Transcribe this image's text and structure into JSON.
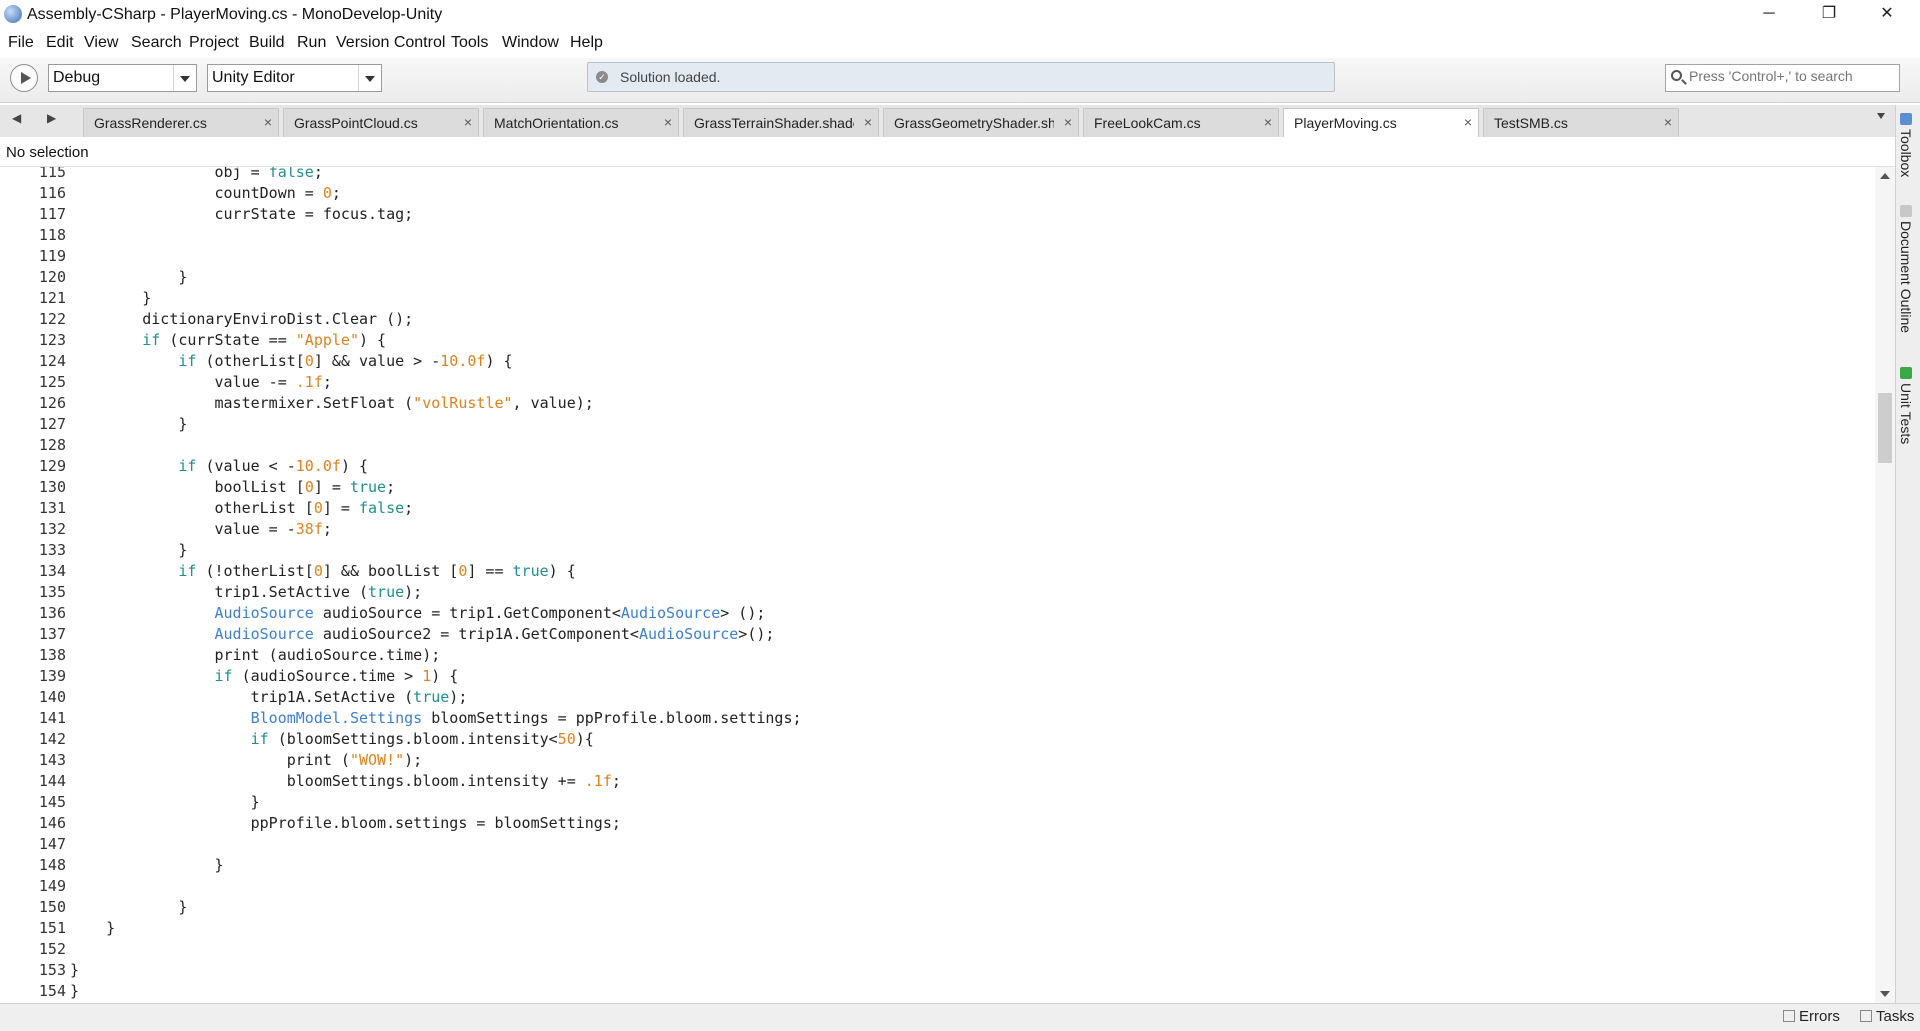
{
  "window": {
    "title": "Assembly-CSharp - PlayerMoving.cs - MonoDevelop-Unity",
    "minimize": "─",
    "restore": "❐",
    "close": "✕"
  },
  "menu": [
    "File",
    "Edit",
    "View",
    "Search",
    "Project",
    "Build",
    "Run",
    "Version Control",
    "Tools",
    "Window",
    "Help"
  ],
  "toolbar": {
    "config": "Debug",
    "target": "Unity Editor",
    "status": "Solution loaded.",
    "search_placeholder": "Press 'Control+,' to search"
  },
  "tabs": [
    {
      "label": "GrassRenderer.cs",
      "active": false
    },
    {
      "label": "GrassPointCloud.cs",
      "active": false
    },
    {
      "label": "MatchOrientation.cs",
      "active": false
    },
    {
      "label": "GrassTerrainShader.shader",
      "active": false
    },
    {
      "label": "GrassGeometryShader.shad",
      "active": false
    },
    {
      "label": "FreeLookCam.cs",
      "active": false
    },
    {
      "label": "PlayerMoving.cs",
      "active": true
    },
    {
      "label": "TestSMB.cs",
      "active": false
    }
  ],
  "tab_nav": {
    "back": "◀",
    "forward": "▶"
  },
  "dock": [
    "Toolbox",
    "Document Outline",
    "Unit Tests"
  ],
  "breadcrumb": "No selection",
  "statusbar": {
    "errors": "Errors",
    "tasks": "Tasks"
  },
  "code": [
    {
      "n": "115",
      "s": [
        [
          "                obj = ",
          ""
        ],
        [
          "false",
          "kw"
        ],
        [
          ";",
          ""
        ]
      ]
    },
    {
      "n": "116",
      "s": [
        [
          "                countDown = ",
          ""
        ],
        [
          "0",
          "num"
        ],
        [
          ";",
          ""
        ]
      ]
    },
    {
      "n": "117",
      "s": [
        [
          "                currState = focus.tag;",
          ""
        ]
      ]
    },
    {
      "n": "118",
      "s": []
    },
    {
      "n": "119",
      "s": []
    },
    {
      "n": "120",
      "s": [
        [
          "            }",
          ""
        ]
      ]
    },
    {
      "n": "121",
      "s": [
        [
          "        }",
          ""
        ]
      ]
    },
    {
      "n": "122",
      "s": [
        [
          "        dictionaryEnviroDist.Clear ();",
          ""
        ]
      ]
    },
    {
      "n": "123",
      "s": [
        [
          "        ",
          ""
        ],
        [
          "if",
          "kw"
        ],
        [
          " (currState == ",
          ""
        ],
        [
          "\"Apple\"",
          "str"
        ],
        [
          ") {",
          ""
        ]
      ]
    },
    {
      "n": "124",
      "s": [
        [
          "            ",
          ""
        ],
        [
          "if",
          "kw"
        ],
        [
          " (otherList[",
          ""
        ],
        [
          "0",
          "num"
        ],
        [
          "] && value > -",
          ""
        ],
        [
          "10.0f",
          "num"
        ],
        [
          ") {",
          ""
        ]
      ]
    },
    {
      "n": "125",
      "s": [
        [
          "                value -= ",
          ""
        ],
        [
          ".1f",
          "num"
        ],
        [
          ";",
          ""
        ]
      ]
    },
    {
      "n": "126",
      "s": [
        [
          "                mastermixer.SetFloat (",
          ""
        ],
        [
          "\"volRustle\"",
          "str"
        ],
        [
          ", value);",
          ""
        ]
      ]
    },
    {
      "n": "127",
      "s": [
        [
          "            }",
          ""
        ]
      ]
    },
    {
      "n": "128",
      "s": []
    },
    {
      "n": "129",
      "s": [
        [
          "            ",
          ""
        ],
        [
          "if",
          "kw"
        ],
        [
          " (value < -",
          ""
        ],
        [
          "10.0f",
          "num"
        ],
        [
          ") {",
          ""
        ]
      ]
    },
    {
      "n": "130",
      "s": [
        [
          "                boolList [",
          ""
        ],
        [
          "0",
          "num"
        ],
        [
          "] = ",
          ""
        ],
        [
          "true",
          "kw"
        ],
        [
          ";",
          ""
        ]
      ]
    },
    {
      "n": "131",
      "s": [
        [
          "                otherList [",
          ""
        ],
        [
          "0",
          "num"
        ],
        [
          "] = ",
          ""
        ],
        [
          "false",
          "kw"
        ],
        [
          ";",
          ""
        ]
      ]
    },
    {
      "n": "132",
      "s": [
        [
          "                value = -",
          ""
        ],
        [
          "38f",
          "num"
        ],
        [
          ";",
          ""
        ]
      ]
    },
    {
      "n": "133",
      "s": [
        [
          "            }",
          ""
        ]
      ]
    },
    {
      "n": "134",
      "s": [
        [
          "            ",
          ""
        ],
        [
          "if",
          "kw"
        ],
        [
          " (!otherList[",
          ""
        ],
        [
          "0",
          "num"
        ],
        [
          "] && boolList [",
          ""
        ],
        [
          "0",
          "num"
        ],
        [
          "] == ",
          ""
        ],
        [
          "true",
          "kw"
        ],
        [
          ") {",
          ""
        ]
      ]
    },
    {
      "n": "135",
      "s": [
        [
          "                trip1.SetActive (",
          ""
        ],
        [
          "true",
          "kw"
        ],
        [
          ");",
          ""
        ]
      ]
    },
    {
      "n": "136",
      "s": [
        [
          "                ",
          ""
        ],
        [
          "AudioSource",
          "typ"
        ],
        [
          " audioSource = trip1.GetComponent<",
          ""
        ],
        [
          "AudioSource",
          "typ"
        ],
        [
          "> ();",
          ""
        ]
      ]
    },
    {
      "n": "137",
      "s": [
        [
          "                ",
          ""
        ],
        [
          "AudioSource",
          "typ"
        ],
        [
          " audioSource2 = trip1A.GetComponent<",
          ""
        ],
        [
          "AudioSource",
          "typ"
        ],
        [
          ">();",
          ""
        ]
      ]
    },
    {
      "n": "138",
      "s": [
        [
          "                print (audioSource.time);",
          ""
        ]
      ]
    },
    {
      "n": "139",
      "s": [
        [
          "                ",
          ""
        ],
        [
          "if",
          "kw"
        ],
        [
          " (audioSource.time > ",
          ""
        ],
        [
          "1",
          "num"
        ],
        [
          ") {",
          ""
        ]
      ]
    },
    {
      "n": "140",
      "s": [
        [
          "                    trip1A.SetActive (",
          ""
        ],
        [
          "true",
          "kw"
        ],
        [
          ");",
          ""
        ]
      ]
    },
    {
      "n": "141",
      "s": [
        [
          "                    ",
          ""
        ],
        [
          "BloomModel.Settings",
          "typ"
        ],
        [
          " bloomSettings = ppProfile.bloom.settings;",
          ""
        ]
      ]
    },
    {
      "n": "142",
      "s": [
        [
          "                    ",
          ""
        ],
        [
          "if",
          "kw"
        ],
        [
          " (bloomSettings.bloom.intensity<",
          ""
        ],
        [
          "50",
          "num"
        ],
        [
          "){",
          ""
        ]
      ]
    },
    {
      "n": "143",
      "s": [
        [
          "                        print (",
          ""
        ],
        [
          "\"WOW!\"",
          "str"
        ],
        [
          ");",
          ""
        ]
      ]
    },
    {
      "n": "144",
      "s": [
        [
          "                        bloomSettings.bloom.intensity += ",
          ""
        ],
        [
          ".1f",
          "num"
        ],
        [
          ";",
          ""
        ]
      ]
    },
    {
      "n": "145",
      "s": [
        [
          "                    }",
          ""
        ]
      ]
    },
    {
      "n": "146",
      "s": [
        [
          "                    ppProfile.bloom.settings = bloomSettings;",
          ""
        ]
      ]
    },
    {
      "n": "147",
      "s": []
    },
    {
      "n": "148",
      "s": [
        [
          "                }",
          ""
        ]
      ]
    },
    {
      "n": "149",
      "s": []
    },
    {
      "n": "150",
      "s": [
        [
          "            }",
          ""
        ]
      ]
    },
    {
      "n": "151",
      "s": [
        [
          "    }",
          ""
        ]
      ]
    },
    {
      "n": "152",
      "s": []
    },
    {
      "n": "153",
      "s": [
        [
          "}",
          ""
        ]
      ]
    },
    {
      "n": "154",
      "s": [
        [
          "}",
          ""
        ]
      ]
    }
  ]
}
